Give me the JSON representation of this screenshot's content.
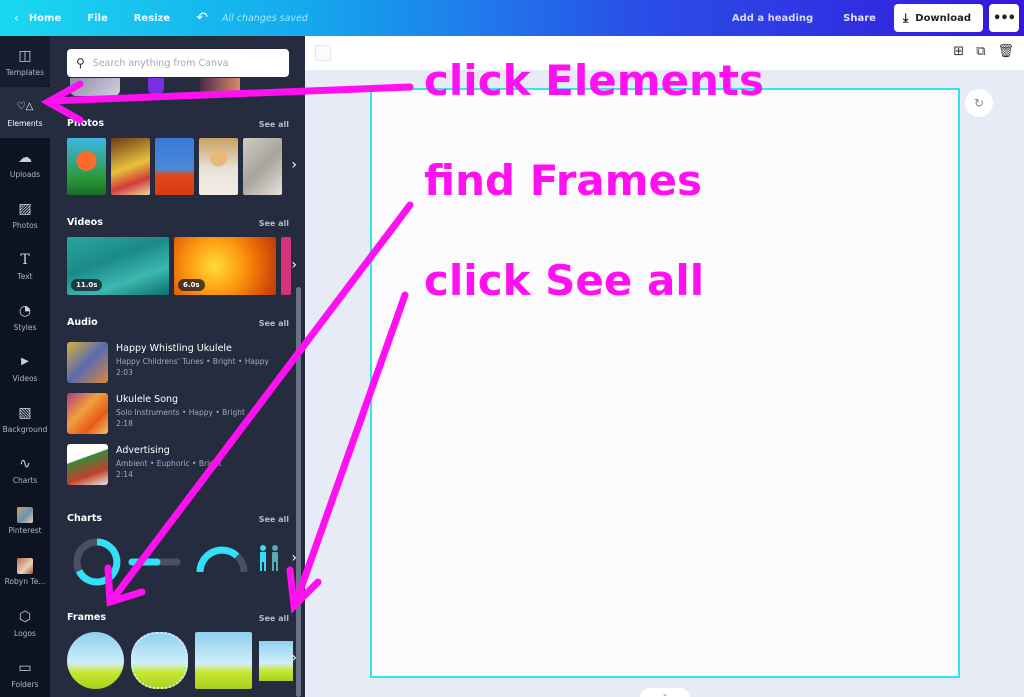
{
  "topbar": {
    "back_icon": "‹",
    "home": "Home",
    "file": "File",
    "resize": "Resize",
    "undo_icon": "↶",
    "status": "All changes saved",
    "add_heading": "Add a heading",
    "share": "Share",
    "download_icon": "⤓",
    "download": "Download",
    "more_icon": "•••"
  },
  "rail": {
    "items": [
      {
        "label": "Templates",
        "icon": "◫"
      },
      {
        "label": "Elements",
        "icon": "♡△"
      },
      {
        "label": "Uploads",
        "icon": "☁"
      },
      {
        "label": "Photos",
        "icon": "▨"
      },
      {
        "label": "Text",
        "icon": "T"
      },
      {
        "label": "Styles",
        "icon": "◔"
      },
      {
        "label": "Videos",
        "icon": "▶"
      },
      {
        "label": "Background",
        "icon": "▧"
      },
      {
        "label": "Charts",
        "icon": "∿"
      },
      {
        "label": "Pinterest",
        "icon": ""
      },
      {
        "label": "Robyn Te...",
        "icon": ""
      },
      {
        "label": "Logos",
        "icon": "⬡"
      },
      {
        "label": "Folders",
        "icon": "▭"
      }
    ],
    "active": "Elements"
  },
  "panel": {
    "search_placeholder": "Search anything from Canva",
    "search_icon": "⚲",
    "see_all": "See all",
    "chevron_icon": "›",
    "sections": {
      "photos": "Photos",
      "videos": "Videos",
      "audio": "Audio",
      "charts": "Charts",
      "frames": "Frames"
    },
    "videos": [
      {
        "duration": "11.0s"
      },
      {
        "duration": "6.0s"
      }
    ],
    "audio": [
      {
        "title": "Happy Whistling Ukulele",
        "tags": "Happy Childrens' Tunes • Bright • Happy",
        "duration": "2:03"
      },
      {
        "title": "Ukulele Song",
        "tags": "Solo Instruments • Happy • Bright",
        "duration": "2:18"
      },
      {
        "title": "Advertising",
        "tags": "Ambient • Euphoric • Bright",
        "duration": "2:14"
      }
    ],
    "collapse_icon": "‹"
  },
  "canvas": {
    "toolbar_icons": [
      "⊞",
      "⧉",
      "🗑"
    ],
    "refresh_icon": "↻",
    "expand_icon": "⌄"
  },
  "annotations": {
    "step1": "click Elements",
    "step2": "find Frames",
    "step3": "click See all",
    "color": "#ff10f0"
  }
}
